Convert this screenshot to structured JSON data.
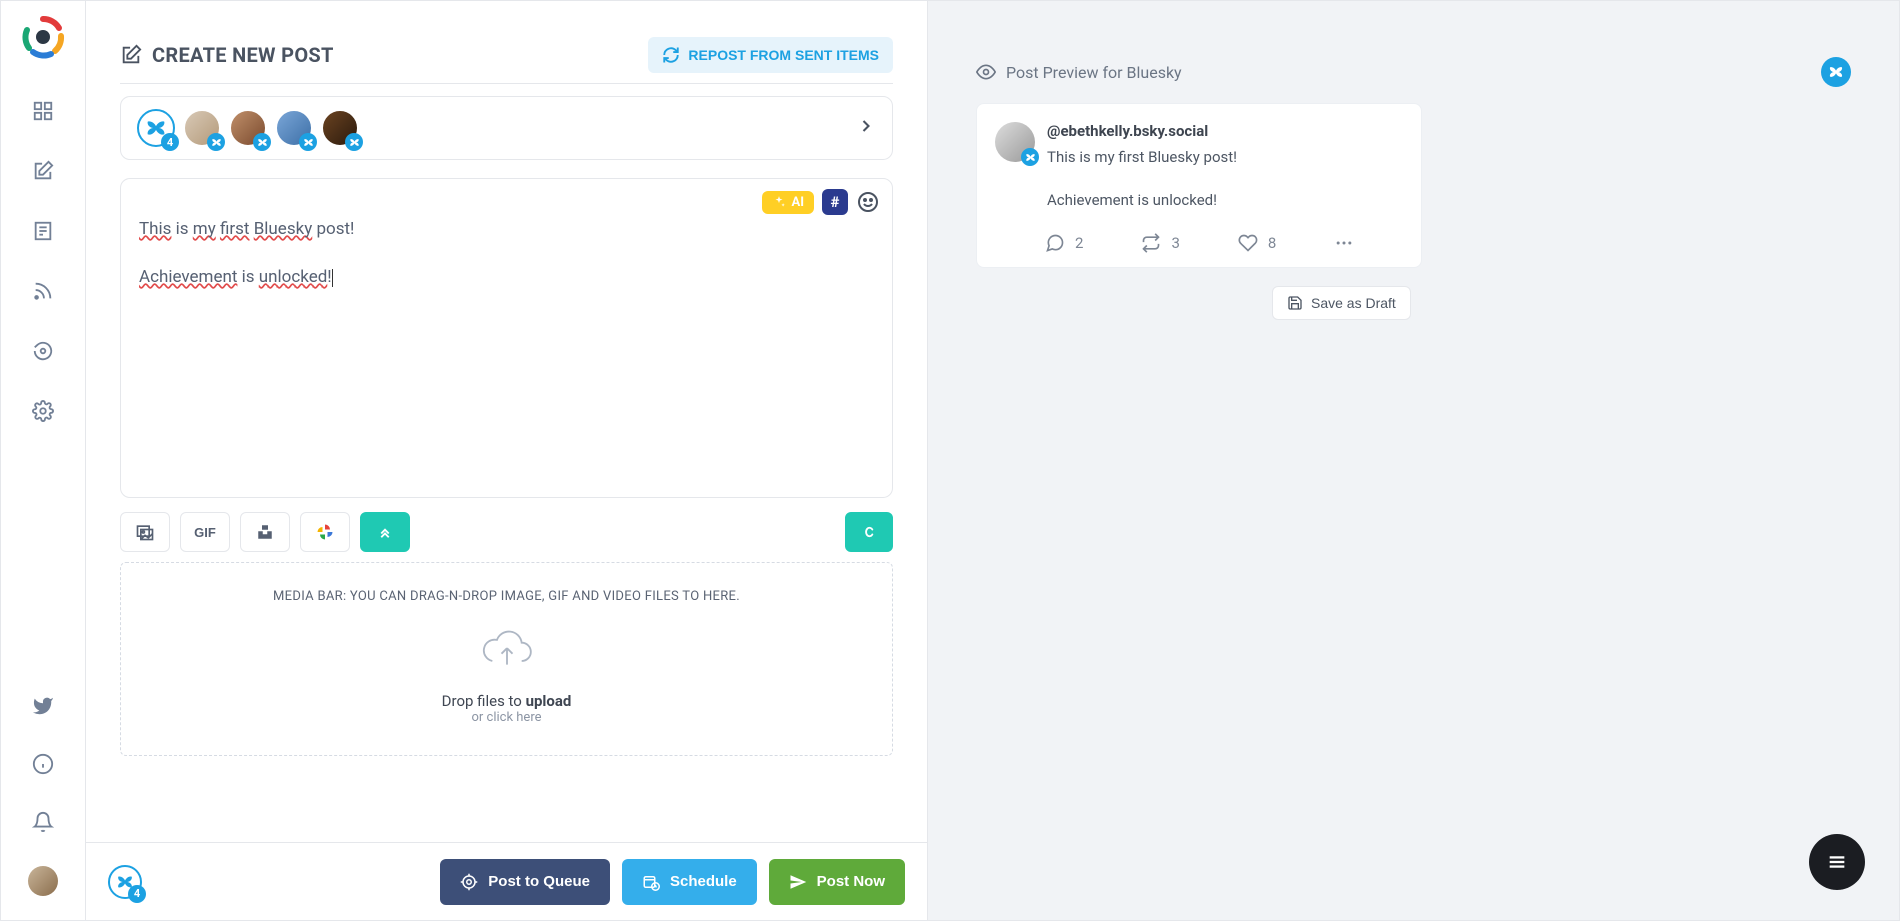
{
  "sidebar": {
    "nav_items": [
      "dashboard",
      "compose",
      "document",
      "rss",
      "refresh",
      "settings"
    ],
    "bottom_items": [
      "twitter",
      "info",
      "bell",
      "avatar"
    ]
  },
  "header": {
    "title": "CREATE NEW POST",
    "repost_label": "REPOST FROM SENT ITEMS"
  },
  "accounts": {
    "selected_count": "4",
    "items": 5
  },
  "editor": {
    "line1_parts": {
      "a": "This",
      "b": " ",
      "c": "is",
      "d": " ",
      "e": "my",
      "f": " ",
      "g": "first",
      "h": " ",
      "i": "Bluesky",
      "j": " ",
      "k": "post!"
    },
    "line2_parts": {
      "a": "Achievement",
      "b": " is ",
      "c": "unlocked",
      "d": "!"
    },
    "ai_label": "AI"
  },
  "media": {
    "gif_label": "GIF",
    "dropzone_label": "MEDIA BAR: YOU CAN DRAG-N-DROP IMAGE, GIF AND VIDEO FILES TO HERE.",
    "drop_main_a": "Drop files to ",
    "drop_main_b": "upload",
    "drop_sub": "or click here"
  },
  "actions": {
    "selected_count": "4",
    "queue_label": "Post to Queue",
    "schedule_label": "Schedule",
    "post_label": "Post Now"
  },
  "preview": {
    "heading": "Post Preview for Bluesky",
    "handle": "@ebethkelly.bsky.social",
    "line1": "This is my first Bluesky post!",
    "line2": "Achievement is unlocked!",
    "replies": "2",
    "reposts": "3",
    "likes": "8",
    "save_draft_label": "Save as Draft"
  }
}
